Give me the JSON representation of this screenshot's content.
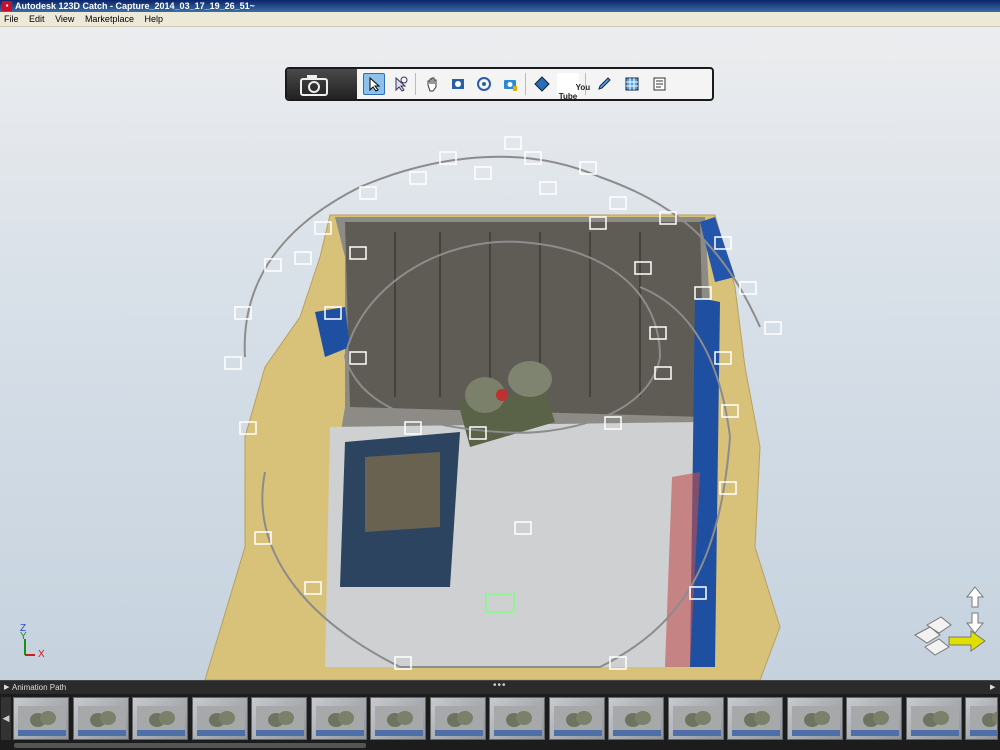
{
  "window": {
    "title": "Autodesk 123D Catch - Capture_2014_03_17_19_26_51~",
    "icon": "app-logo-icon"
  },
  "menu": {
    "items": [
      "File",
      "Edit",
      "View",
      "Marketplace",
      "Help"
    ]
  },
  "toolbar": {
    "tools": [
      "camera-capture-icon",
      "select-arrow-icon",
      "select-lasso-icon",
      "pan-hand-icon",
      "zoom-icon",
      "orbit-icon",
      "camera-lock-icon",
      "texture-icon",
      "youtube-icon",
      "pen-icon",
      "export-grid-icon",
      "notes-icon"
    ],
    "youtube_label": "You\nTube"
  },
  "timeline": {
    "label": "Animation Path",
    "dots": "•••",
    "thumbnail_count": 17
  },
  "colors": {
    "title_bar": "#0a246a",
    "menu_bar": "#ece9d8",
    "timeline_bg": "#1c1c1c",
    "active_tool": "#8ec0ec",
    "nav_arrow": "#e0e000"
  },
  "axis_gizmo": {
    "x_label": "X",
    "y_label": "Y",
    "z_label": "Z"
  }
}
